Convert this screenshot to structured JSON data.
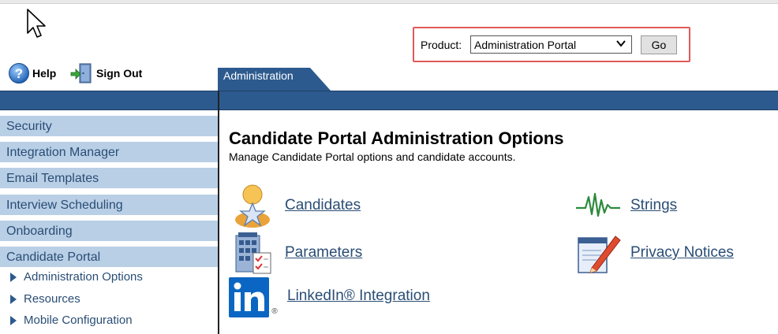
{
  "product": {
    "label": "Product:",
    "selected": "Administration Portal",
    "go_label": "Go"
  },
  "utility": {
    "help_label": "Help",
    "signout_label": "Sign Out"
  },
  "tab": {
    "label": "Administration"
  },
  "sidebar": {
    "items": [
      {
        "label": "Security"
      },
      {
        "label": "Integration Manager"
      },
      {
        "label": "Email Templates"
      },
      {
        "label": "Interview Scheduling"
      },
      {
        "label": "Onboarding"
      },
      {
        "label": "Candidate Portal"
      }
    ],
    "subitems": [
      {
        "label": "Administration Options"
      },
      {
        "label": "Resources"
      },
      {
        "label": "Mobile Configuration"
      }
    ]
  },
  "main": {
    "title": "Candidate Portal Administration Options",
    "subtitle": "Manage Candidate Portal options and candidate accounts.",
    "options": [
      {
        "label": "Candidates",
        "icon": "candidate-star-icon"
      },
      {
        "label": "Parameters",
        "icon": "building-checklist-icon"
      },
      {
        "label": "LinkedIn® Integration",
        "icon": "linkedin-icon"
      },
      {
        "label": "Strings",
        "icon": "waveform-icon"
      },
      {
        "label": "Privacy Notices",
        "icon": "document-pen-icon"
      }
    ]
  },
  "colors": {
    "nav_bar": "#2c5a8e",
    "sidebar_item_bg": "#b9cfe6",
    "link": "#2a4d75",
    "highlight_border": "#e05a5a",
    "linkedin_blue": "#0a66c2"
  }
}
